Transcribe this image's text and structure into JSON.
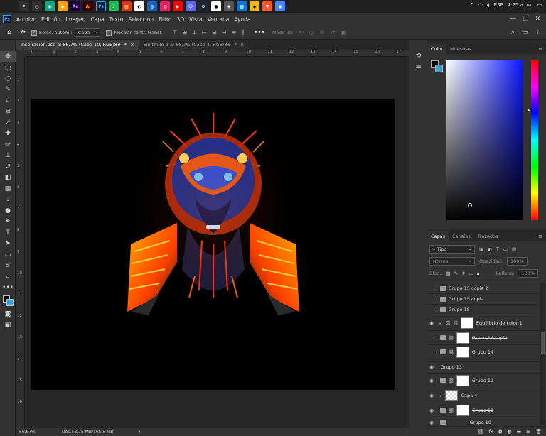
{
  "menu": {
    "app_logo": "Ps",
    "items": [
      "Archivo",
      "Edición",
      "Imagen",
      "Capa",
      "Texto",
      "Selección",
      "Filtro",
      "3D",
      "Vista",
      "Ventana",
      "Ayuda"
    ]
  },
  "system_tray": {
    "language": "ESP",
    "time": "4:25 a. m."
  },
  "options_bar": {
    "auto_select_label": "Selec. autom.:",
    "auto_select_value": "Capa",
    "show_transform_label": "Mostrar contr. transf.",
    "mode_3d_label": "Modo 3D:"
  },
  "document_tabs": [
    {
      "label": "Inspiracion.psd al 66,7% (Capa 10, RGB/8#) *",
      "active": true
    },
    {
      "label": "Sin título-1 al 66,7% (Capa 4, RGB/8#) *",
      "active": false
    }
  ],
  "ruler_h": [
    "0",
    "1",
    "2",
    "3",
    "4",
    "5",
    "6",
    "7",
    "8",
    "9",
    "10",
    "11",
    "12",
    "13",
    "14",
    "15",
    "16",
    "17"
  ],
  "ruler_v": [
    "1",
    "2",
    "3",
    "4",
    "5",
    "6",
    "7",
    "8",
    "9",
    "10",
    "11",
    "12",
    "13",
    "14",
    "15",
    "16"
  ],
  "status_bar": {
    "zoom": "66,67%",
    "doc": "Doc.: 3,75 MB/165,5 MB"
  },
  "color_panel": {
    "tabs": [
      "Color",
      "Muestras"
    ],
    "foreground": "#000000",
    "background": "#37a4d9"
  },
  "layers_panel": {
    "tabs": [
      "Capas",
      "Canales",
      "Trazados"
    ],
    "filter_kind": "Tipo",
    "blend_mode": "Normal",
    "opacity_label": "Opacidad:",
    "opacity_value": "100%",
    "lock_label": "Bloq.:",
    "fill_label": "Relleno:",
    "fill_value": "100%",
    "layers": [
      {
        "name": "Grupo 15 copia 2",
        "type": "group",
        "visible": false
      },
      {
        "name": "Grupo 15 copia",
        "type": "group",
        "visible": false
      },
      {
        "name": "Grupo 15",
        "type": "group",
        "visible": false
      },
      {
        "name": "Equilibrio de color 1",
        "type": "adjustment",
        "visible": true
      },
      {
        "name": "Grupo 14 copia",
        "type": "group-mask",
        "visible": false
      },
      {
        "name": "Grupo 14",
        "type": "group-mask",
        "visible": false
      },
      {
        "name": "Grupo 13",
        "type": "group",
        "visible": true
      },
      {
        "name": "Grupo 12",
        "type": "group-mask",
        "visible": true
      },
      {
        "name": "Capa 4",
        "type": "pixel",
        "visible": true
      },
      {
        "name": "Grupo 11",
        "type": "group-mask",
        "visible": true
      },
      {
        "name": "Grupo 10",
        "type": "group-mask",
        "visible": true
      }
    ]
  }
}
